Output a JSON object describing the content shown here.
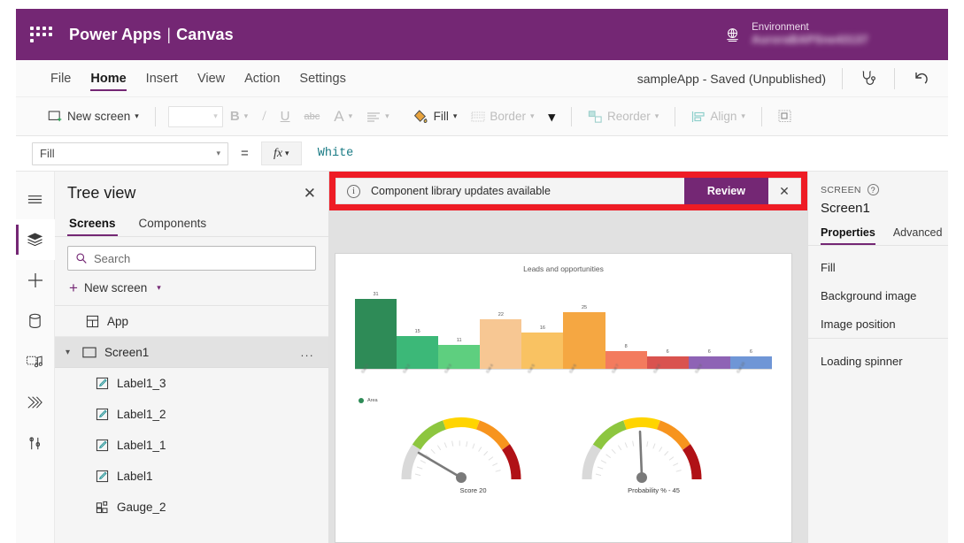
{
  "header": {
    "waffle_icon": "app-launcher-icon",
    "brand": "Power Apps",
    "brand_separator": "|",
    "brand_sub": "Canvas",
    "globe_icon": "environment-globe-icon",
    "environment_label": "Environment",
    "environment_name": "AuroraBAPSne43137"
  },
  "menubar": {
    "items": [
      {
        "label": "File",
        "active": false
      },
      {
        "label": "Home",
        "active": true
      },
      {
        "label": "Insert",
        "active": false
      },
      {
        "label": "View",
        "active": false
      },
      {
        "label": "Action",
        "active": false
      },
      {
        "label": "Settings",
        "active": false
      }
    ],
    "save_status": "sampleApp - Saved (Unpublished)",
    "checker_icon": "app-checker-stethoscope-icon",
    "undo_icon": "undo-arrow-icon"
  },
  "toolbar": {
    "new_screen": "New screen",
    "font_value": "",
    "bold": "B",
    "italic": "I",
    "underline": "U",
    "strikethrough": "abc",
    "font_color": "A",
    "align": "align-icon",
    "fill": "Fill",
    "border": "Border",
    "more": "chevron-down-icon",
    "reorder": "Reorder",
    "align_label": "Align",
    "group": "group-icon"
  },
  "formulabar": {
    "property": "Fill",
    "equals": "=",
    "fx": "fx",
    "value": "White"
  },
  "rail": {
    "items": [
      {
        "name": "hamburger-menu-icon",
        "active": false
      },
      {
        "name": "tree-view-layers-icon",
        "active": true
      },
      {
        "name": "insert-plus-icon",
        "active": false
      },
      {
        "name": "data-sources-icon",
        "active": false
      },
      {
        "name": "media-icon",
        "active": false
      },
      {
        "name": "power-automate-flow-icon",
        "active": false
      },
      {
        "name": "variables-tools-icon",
        "active": false
      }
    ]
  },
  "treeview": {
    "title": "Tree view",
    "close_icon": "close-icon",
    "tabs": [
      {
        "label": "Screens",
        "active": true
      },
      {
        "label": "Components",
        "active": false
      }
    ],
    "search_placeholder": "Search",
    "search_icon": "search-icon",
    "new_screen": "New screen",
    "items": [
      {
        "label": "App",
        "icon": "app-icon",
        "type": "app",
        "indent": 0
      },
      {
        "label": "Screen1",
        "icon": "screen-icon",
        "type": "screen",
        "indent": 0,
        "expanded": true,
        "selected": true,
        "overflow": "..."
      },
      {
        "label": "Label1_3",
        "icon": "label-icon",
        "type": "control",
        "indent": 1
      },
      {
        "label": "Label1_2",
        "icon": "label-icon",
        "type": "control",
        "indent": 1
      },
      {
        "label": "Label1_1",
        "icon": "label-icon",
        "type": "control",
        "indent": 1
      },
      {
        "label": "Label1",
        "icon": "label-icon",
        "type": "control",
        "indent": 1
      },
      {
        "label": "Gauge_2",
        "icon": "gauge-component-icon",
        "type": "control",
        "indent": 1
      }
    ]
  },
  "notification": {
    "info_icon": "info-circle-icon",
    "message": "Component library updates available",
    "review_label": "Review",
    "close_icon": "close-icon",
    "accent_color": "#742774",
    "highlight_color": "#ee1c25"
  },
  "properties_panel": {
    "kicker": "SCREEN",
    "help_icon": "help-question-icon",
    "selected": "Screen1",
    "tabs": [
      {
        "label": "Properties",
        "active": true
      },
      {
        "label": "Advanced",
        "active": false
      }
    ],
    "rows": [
      "Fill",
      "Background image",
      "Image position"
    ],
    "footer": "Loading spinner"
  },
  "chart_data": [
    {
      "type": "bar",
      "title": "Leads and opportunities",
      "categories": [
        "Cat 1",
        "Cat 2",
        "Cat 3",
        "Cat 4",
        "Cat 5",
        "Cat 6",
        "Cat 7",
        "Cat 8",
        "Cat 9",
        "Cat 10"
      ],
      "values": [
        31,
        15,
        11,
        22,
        16,
        25,
        8,
        6,
        6,
        6
      ],
      "colors": [
        "#2e8b57",
        "#3cb878",
        "#5ecf7f",
        "#f7c793",
        "#f9c262",
        "#f5a742",
        "#f37b5e",
        "#d9534f",
        "#8e63b5",
        "#6f96d6"
      ],
      "xlabel": "",
      "ylabel": "",
      "ylim": [
        0,
        34
      ],
      "grid": false,
      "legend": [
        "Area"
      ],
      "legend_position": "bottom-left",
      "legend_color": "#2e8b57",
      "data_labels": true
    },
    {
      "type": "gauge",
      "title": "Score",
      "caption": "Score   20",
      "value": 20,
      "min": 0,
      "max": 100,
      "bands": [
        "#d9d9d9",
        "#8dc63f",
        "#ffd400",
        "#f7941e",
        "#b01116"
      ]
    },
    {
      "type": "gauge",
      "title": "Probability %",
      "caption": "Probability % -  45",
      "value": 45,
      "min": 0,
      "max": 100,
      "bands": [
        "#d9d9d9",
        "#8dc63f",
        "#ffd400",
        "#f7941e",
        "#b01116"
      ]
    }
  ]
}
